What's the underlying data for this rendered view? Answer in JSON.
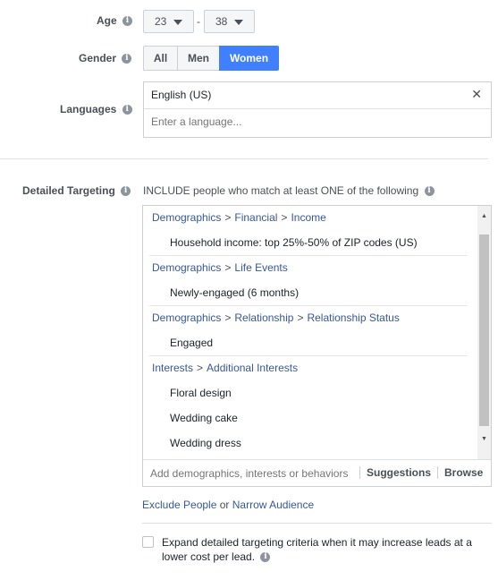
{
  "age": {
    "label": "Age",
    "min": "23",
    "dash": "-",
    "max": "38"
  },
  "gender": {
    "label": "Gender",
    "options": [
      "All",
      "Men",
      "Women"
    ],
    "selected": "Women"
  },
  "languages": {
    "label": "Languages",
    "selected": "English (US)",
    "clear_symbol": "✕",
    "placeholder": "Enter a language..."
  },
  "detailed_targeting": {
    "label": "Detailed Targeting",
    "description": "INCLUDE people who match at least ONE of the following",
    "groups": [
      {
        "path": [
          "Demographics",
          "Financial",
          "Income"
        ],
        "items": [
          "Household income: top 25%-50% of ZIP codes (US)"
        ]
      },
      {
        "path": [
          "Demographics",
          "Life Events"
        ],
        "items": [
          "Newly-engaged (6 months)"
        ]
      },
      {
        "path": [
          "Demographics",
          "Relationship",
          "Relationship Status"
        ],
        "items": [
          "Engaged"
        ]
      },
      {
        "path": [
          "Interests",
          "Additional Interests"
        ],
        "items": [
          "Floral design",
          "Wedding cake",
          "Wedding dress"
        ]
      }
    ],
    "separator": ">",
    "search_placeholder": "Add demographics, interests or behaviors",
    "suggestions_label": "Suggestions",
    "browse_label": "Browse",
    "scroll_up": "▲",
    "scroll_down": "▼"
  },
  "exclude": {
    "exclude_label": "Exclude People",
    "or_text": "or",
    "narrow_label": "Narrow Audience"
  },
  "expand": {
    "line1": "Expand detailed targeting criteria when it may increase leads at a",
    "line2": "lower cost per lead.",
    "checked": false
  },
  "colors": {
    "accent": "#4080ff",
    "link": "#365899",
    "label": "#4b4f56"
  },
  "icons": {
    "info": "info-icon",
    "caret": "caret-down-icon",
    "clear": "close-icon"
  }
}
